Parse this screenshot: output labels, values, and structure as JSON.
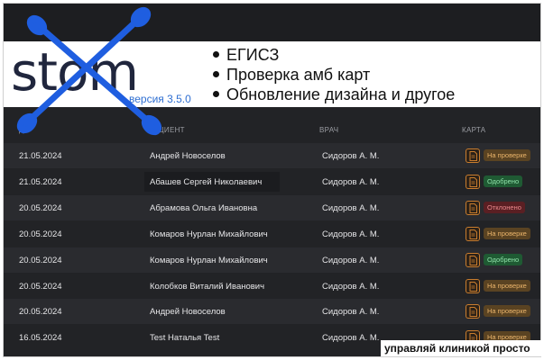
{
  "banner": {
    "logo": "stom",
    "version": "версия 3.5.0",
    "features": [
      "ЕГИСЗ",
      "Проверка амб карт",
      "Обновление дизайна и другое"
    ]
  },
  "table": {
    "headers": {
      "date": "Д",
      "patient": "ПАЦИЕНТ",
      "doctor": "ВРАЧ",
      "card": "КАРТА"
    },
    "rows": [
      {
        "date": "21.05.2024",
        "patient": "Андрей Новоселов",
        "doctor": "Сидоров А. М.",
        "status": "На проверке",
        "status_type": "review"
      },
      {
        "date": "21.05.2024",
        "patient": "Абашев Сергей Николаевич",
        "doctor": "Сидоров А. М.",
        "status": "Одобрено",
        "status_type": "ok"
      },
      {
        "date": "20.05.2024",
        "patient": "Абрамова Ольга Ивановна",
        "doctor": "Сидоров А. М.",
        "status": "Отклонено",
        "status_type": "rej"
      },
      {
        "date": "20.05.2024",
        "patient": "Комаров Нурлан Михайлович",
        "doctor": "Сидоров А. М.",
        "status": "На проверке",
        "status_type": "review"
      },
      {
        "date": "20.05.2024",
        "patient": "Комаров Нурлан Михайлович",
        "doctor": "Сидоров А. М.",
        "status": "Одобрено",
        "status_type": "ok"
      },
      {
        "date": "20.05.2024",
        "patient": "Колобков Виталий Иванович",
        "doctor": "Сидоров А. М.",
        "status": "На проверке",
        "status_type": "review"
      },
      {
        "date": "20.05.2024",
        "patient": "Андрей Новоселов",
        "doctor": "Сидоров А. М.",
        "status": "На проверке",
        "status_type": "review"
      },
      {
        "date": "16.05.2024",
        "patient": "Test Наталья Test",
        "doctor": "Сидоров А. М.",
        "status": "На проверке",
        "status_type": "review"
      }
    ]
  },
  "tagline": "управляй клиникой просто",
  "colors": {
    "accent_blue": "#1f5ee0",
    "background": "#222326",
    "review": "#e9b36a",
    "ok": "#8fe2a9",
    "rejected": "#ec8a8e",
    "doc_icon": "#c97d2e"
  },
  "icons": {
    "card": "document-icon"
  }
}
